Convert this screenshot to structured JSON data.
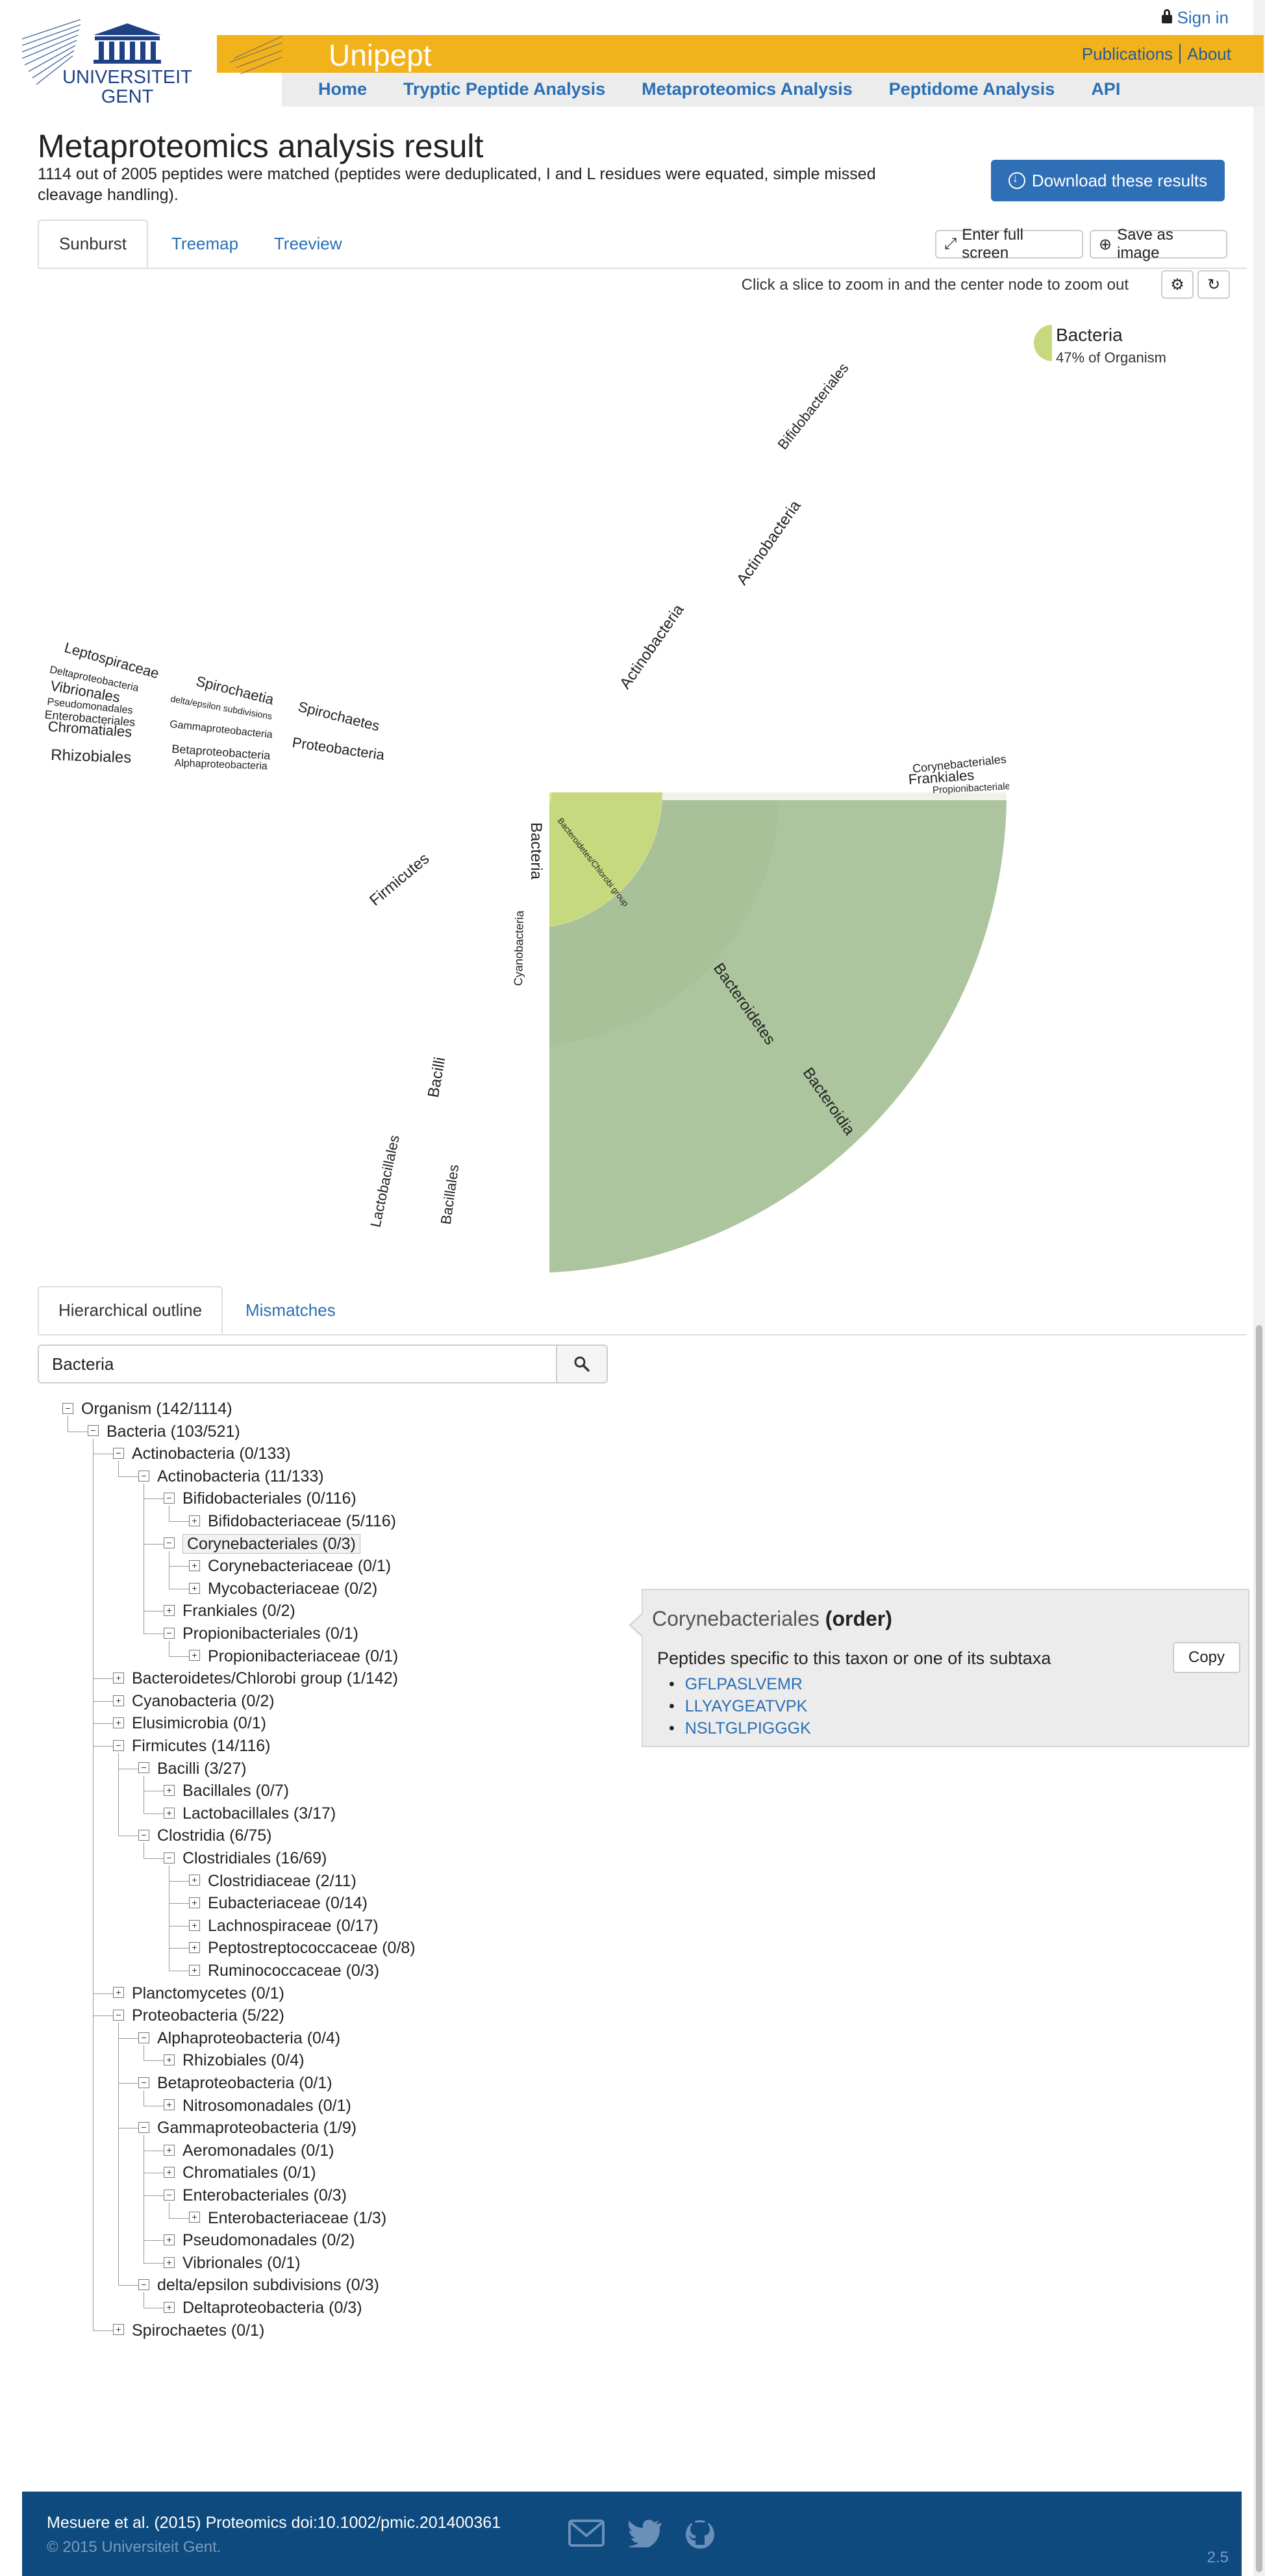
{
  "header": {
    "sign_in": "Sign in",
    "university": [
      "UNIVERSITEIT",
      "GENT"
    ],
    "brand": "Unipept",
    "top_links": [
      "Publications",
      "About"
    ],
    "nav": [
      "Home",
      "Tryptic Peptide Analysis",
      "Metaproteomics Analysis",
      "Peptidome Analysis",
      "API"
    ]
  },
  "page": {
    "title": "Metaproteomics analysis result",
    "subtitle": "1114 out of 2005 peptides were matched (peptides were deduplicated, I and L residues were equated, simple missed cleavage handling).",
    "download_label": "Download these results"
  },
  "viz_tabs": [
    "Sunburst",
    "Treemap",
    "Treeview"
  ],
  "viz_tools": {
    "fullscreen": "Enter full screen",
    "save_image": "Save as image",
    "hint": "Click a slice to zoom in and the center node to zoom out"
  },
  "legend": {
    "name": "Bacteria",
    "pct": "47% of Organism"
  },
  "sunburst_labels": {
    "center": "Bacteria",
    "actinobacteria": "Actinobacteria",
    "actinobacteria2": "Actinobacteria",
    "bifidobacteriales": "Bifidobacteriales",
    "corynebacteriales": "Corynebacteriales",
    "frankiales": "Frankiales",
    "propionibacteriales": "Propionibacteriales",
    "bacteroidetes_chlorobi": "Bacteroidetes/Chlorobi group",
    "bacteroidetes": "Bacteroidetes",
    "bacteroidia": "Bacteroidia",
    "firmicutes": "Firmicutes",
    "clostridia": "Clostridia",
    "clostridiales": "Clostridiales",
    "bacilli": "Bacilli",
    "lactobacillales": "Lactobacillales",
    "bacillales": "Bacillales",
    "elusimicrobia": "Elusimicrobia",
    "elusimicrobia2": "Elusimicrobia",
    "cyanobacteria": "Cyanobacteria",
    "proteobacteria": "Proteobacteria",
    "planctomycetes": "Planctomycetes",
    "spirochaetes": "Spirochaetes",
    "spirochaetia": "Spirochaetia",
    "leptospiraceae": "Leptospiraceae",
    "deltaproteobacteria": "Deltaproteobacteria",
    "vibrionales": "Vibrionales",
    "pseudomonadales": "Pseudomonadales",
    "enterobacteriales": "Enterobacteriales",
    "chromatiales": "Chromatiales",
    "rhizobiales": "Rhizobiales",
    "delta_epsilon": "delta/epsilon subdivisions",
    "gammaproteobacteria": "Gammaproteobacteria",
    "betaproteobacteria": "Betaproteobacteria",
    "alphaproteobacteria": "Alphaproteobacteria"
  },
  "outline_tabs": [
    "Hierarchical outline",
    "Mismatches"
  ],
  "search": {
    "value": "Bacteria"
  },
  "tree": [
    {
      "label": "Organism (142/1114)",
      "depth": 0,
      "expanded": true
    },
    {
      "label": "Bacteria (103/521)",
      "depth": 1,
      "expanded": true
    },
    {
      "label": "Actinobacteria (0/133)",
      "depth": 2,
      "expanded": true
    },
    {
      "label": "Actinobacteria (11/133)",
      "depth": 3,
      "expanded": true
    },
    {
      "label": "Bifidobacteriales (0/116)",
      "depth": 4,
      "expanded": true
    },
    {
      "label": "Bifidobacteriaceae (5/116)",
      "depth": 5,
      "expanded": false
    },
    {
      "label": "Corynebacteriales (0/3)",
      "depth": 4,
      "expanded": true,
      "highlight": true
    },
    {
      "label": "Corynebacteriaceae (0/1)",
      "depth": 5,
      "expanded": false
    },
    {
      "label": "Mycobacteriaceae (0/2)",
      "depth": 5,
      "expanded": false
    },
    {
      "label": "Frankiales (0/2)",
      "depth": 4,
      "expanded": false
    },
    {
      "label": "Propionibacteriales (0/1)",
      "depth": 4,
      "expanded": true
    },
    {
      "label": "Propionibacteriaceae (0/1)",
      "depth": 5,
      "expanded": false
    },
    {
      "label": "Bacteroidetes/Chlorobi group (1/142)",
      "depth": 2,
      "expanded": false
    },
    {
      "label": "Cyanobacteria (0/2)",
      "depth": 2,
      "expanded": false
    },
    {
      "label": "Elusimicrobia (0/1)",
      "depth": 2,
      "expanded": false
    },
    {
      "label": "Firmicutes (14/116)",
      "depth": 2,
      "expanded": true
    },
    {
      "label": "Bacilli (3/27)",
      "depth": 3,
      "expanded": true
    },
    {
      "label": "Bacillales (0/7)",
      "depth": 4,
      "expanded": false
    },
    {
      "label": "Lactobacillales (3/17)",
      "depth": 4,
      "expanded": false
    },
    {
      "label": "Clostridia (6/75)",
      "depth": 3,
      "expanded": true
    },
    {
      "label": "Clostridiales (16/69)",
      "depth": 4,
      "expanded": true
    },
    {
      "label": "Clostridiaceae (2/11)",
      "depth": 5,
      "expanded": false
    },
    {
      "label": "Eubacteriaceae (0/14)",
      "depth": 5,
      "expanded": false
    },
    {
      "label": "Lachnospiraceae (0/17)",
      "depth": 5,
      "expanded": false
    },
    {
      "label": "Peptostreptococcaceae (0/8)",
      "depth": 5,
      "expanded": false
    },
    {
      "label": "Ruminococcaceae (0/3)",
      "depth": 5,
      "expanded": false
    },
    {
      "label": "Planctomycetes (0/1)",
      "depth": 2,
      "expanded": false
    },
    {
      "label": "Proteobacteria (5/22)",
      "depth": 2,
      "expanded": true
    },
    {
      "label": "Alphaproteobacteria (0/4)",
      "depth": 3,
      "expanded": true
    },
    {
      "label": "Rhizobiales (0/4)",
      "depth": 4,
      "expanded": false
    },
    {
      "label": "Betaproteobacteria (0/1)",
      "depth": 3,
      "expanded": true
    },
    {
      "label": "Nitrosomonadales (0/1)",
      "depth": 4,
      "expanded": false
    },
    {
      "label": "Gammaproteobacteria (1/9)",
      "depth": 3,
      "expanded": true
    },
    {
      "label": "Aeromonadales (0/1)",
      "depth": 4,
      "expanded": false
    },
    {
      "label": "Chromatiales (0/1)",
      "depth": 4,
      "expanded": false
    },
    {
      "label": "Enterobacteriales (0/3)",
      "depth": 4,
      "expanded": true
    },
    {
      "label": "Enterobacteriaceae (1/3)",
      "depth": 5,
      "expanded": false
    },
    {
      "label": "Pseudomonadales (0/2)",
      "depth": 4,
      "expanded": false
    },
    {
      "label": "Vibrionales (0/1)",
      "depth": 4,
      "expanded": false
    },
    {
      "label": "delta/epsilon subdivisions (0/3)",
      "depth": 3,
      "expanded": true
    },
    {
      "label": "Deltaproteobacteria (0/3)",
      "depth": 4,
      "expanded": false
    },
    {
      "label": "Spirochaetes (0/1)",
      "depth": 2,
      "expanded": false
    }
  ],
  "tooltip": {
    "name": "Corynebacteriales",
    "rank": "(order)",
    "subtitle": "Peptides specific to this taxon or one of its subtaxa",
    "copy": "Copy",
    "peptides": [
      "GFLPASLVEMR",
      "LLYAYGEATVPK",
      "NSLTGLPIGGGK"
    ]
  },
  "footer": {
    "citation": "Mesuere et al. (2015) Proteomics doi:10.1002/pmic.201400361",
    "copyright": "© 2015 Universiteit Gent.",
    "version": "2.5"
  },
  "colors": {
    "yellow_bar": "#f2b21b",
    "link": "#2a6fb5",
    "footer": "#0e4a7d",
    "actino": "#e8d278",
    "bacteroid": "#a9c29a",
    "firmicutes": "#4bb39b",
    "clostridia": "#9a5a98",
    "bacilli": "#cc8a4c",
    "proteo": "#d682c0",
    "center": "#c7d97f"
  }
}
